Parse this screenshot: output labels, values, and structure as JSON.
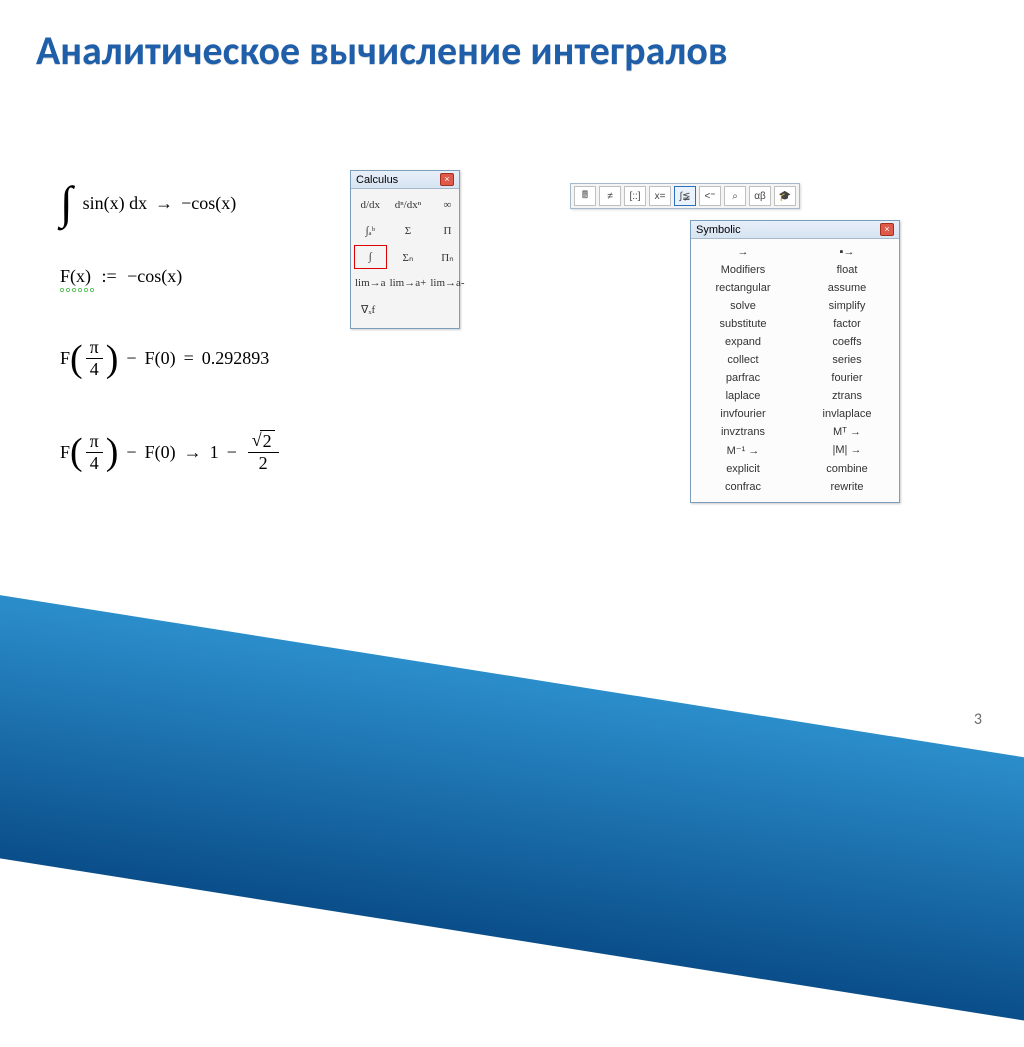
{
  "title": "Аналитическое вычисление интегралов",
  "page_number": "3",
  "math": {
    "integral": {
      "expr": "sin(x) dx",
      "arrow": "→",
      "result": "−cos(x)"
    },
    "assign": {
      "lhs": "F(x)",
      "op": ":=",
      "rhs": "−cos(x)"
    },
    "numeric": {
      "F": "F",
      "pi": "π",
      "four": "4",
      "minus": "−",
      "F0": "F(0)",
      "eq": "=",
      "val": "0.292893"
    },
    "symbolic": {
      "F": "F",
      "pi": "π",
      "four": "4",
      "minus": "−",
      "F0": "F(0)",
      "arrow": "→",
      "one": "1",
      "minus2": "−",
      "sqrt_of": "2",
      "two": "2"
    }
  },
  "calculus_panel": {
    "title": "Calculus",
    "buttons": [
      "d/dx",
      "dⁿ/dxⁿ",
      "∞",
      "∫ₐᵇ",
      "Σ",
      "Π",
      "∫",
      "Σₙ",
      "Πₙ",
      "lim→a",
      "lim→a+",
      "lim→a-"
    ],
    "gradient": "∇ₓf",
    "selected_index": 6
  },
  "toolbar_strip": {
    "buttons": [
      "🖩",
      "≠",
      "[::]",
      "x=",
      "∫≨",
      "<⁼",
      "⌕",
      "αβ",
      "🎓"
    ],
    "highlighted_index": 4
  },
  "symbolic_panel": {
    "title": "Symbolic",
    "items": [
      "→",
      "▪→",
      "Modifiers",
      "float",
      "rectangular",
      "assume",
      "solve",
      "simplify",
      "substitute",
      "factor",
      "expand",
      "coeffs",
      "collect",
      "series",
      "parfrac",
      "fourier",
      "laplace",
      "ztrans",
      "invfourier",
      "invlaplace",
      "invztrans",
      "Mᵀ →",
      "M⁻¹ →",
      "|M| →",
      "explicit",
      "combine",
      "confrac",
      "rewrite"
    ]
  }
}
